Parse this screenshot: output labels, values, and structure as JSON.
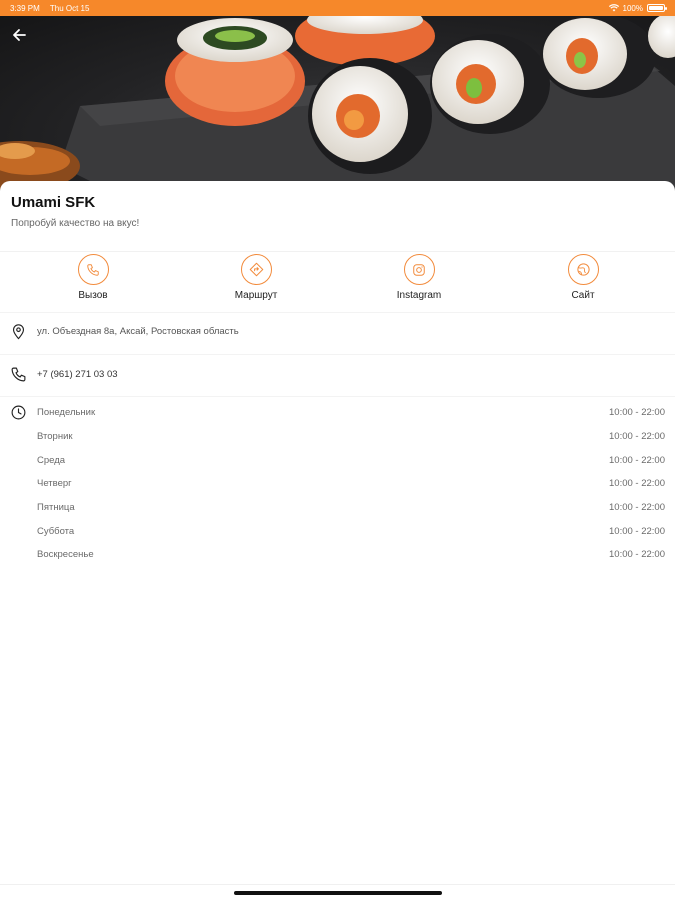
{
  "status_bar": {
    "time": "3:39 PM",
    "date": "Thu Oct 15",
    "battery": "100%",
    "color": "#f6882a"
  },
  "header": {
    "back_icon": "arrow-left-icon",
    "image": "sushi-rolls-photo"
  },
  "place": {
    "name": "Umami SFK",
    "tagline": "Попробуй качество на вкус!"
  },
  "actions": [
    {
      "label": "Вызов",
      "icon": "phone-icon"
    },
    {
      "label": "Маршрут",
      "icon": "directions-icon"
    },
    {
      "label": "Instagram",
      "icon": "instagram-icon"
    },
    {
      "label": "Сайт",
      "icon": "globe-icon"
    }
  ],
  "accent_color": "#f28b3c",
  "address": "ул. Объездная 8а, Аксай, Ростовская область",
  "phone": "+7 (961) 271 03 03",
  "hours": [
    {
      "day": "Понедельник",
      "time": "10:00 - 22:00"
    },
    {
      "day": "Вторник",
      "time": "10:00 - 22:00"
    },
    {
      "day": "Среда",
      "time": "10:00 - 22:00"
    },
    {
      "day": "Четверг",
      "time": "10:00 - 22:00"
    },
    {
      "day": "Пятница",
      "time": "10:00 - 22:00"
    },
    {
      "day": "Суббота",
      "time": "10:00 - 22:00"
    },
    {
      "day": "Воскресенье",
      "time": "10:00 - 22:00"
    }
  ]
}
